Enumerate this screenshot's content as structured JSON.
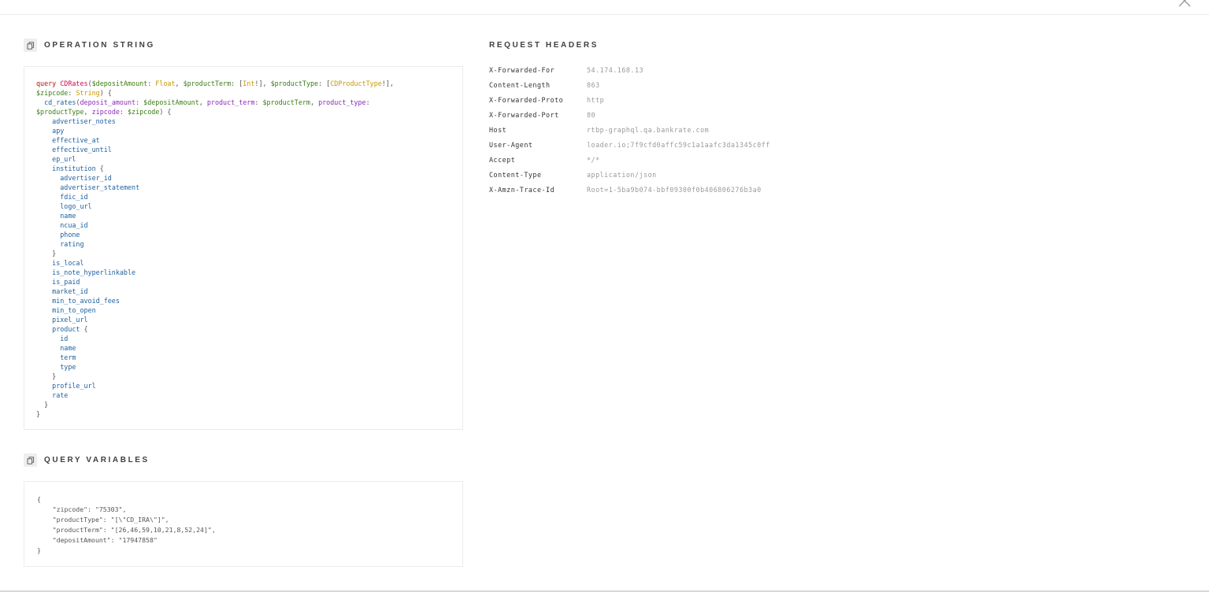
{
  "window": {
    "close_icon": "close-icon"
  },
  "operation": {
    "title": "OPERATION STRING",
    "copy_icon": "copy-icon",
    "lines": [
      [
        [
          "kw",
          "query "
        ],
        [
          "def",
          "CDRates"
        ],
        [
          "punct",
          "("
        ],
        [
          "var",
          "$depositAmount"
        ],
        [
          "punct",
          ": "
        ],
        [
          "type",
          "Float"
        ],
        [
          "punct",
          ", "
        ],
        [
          "var",
          "$productTerm"
        ],
        [
          "punct",
          ": ["
        ],
        [
          "type",
          "Int"
        ],
        [
          "punct",
          "!], "
        ],
        [
          "var",
          "$productType"
        ],
        [
          "punct",
          ": ["
        ],
        [
          "type",
          "CDProductType"
        ],
        [
          "punct",
          "!],"
        ]
      ],
      [
        [
          "var",
          "$zipcode"
        ],
        [
          "punct",
          ": "
        ],
        [
          "type",
          "String"
        ],
        [
          "punct",
          ") {"
        ]
      ],
      [
        [
          "punct",
          "  "
        ],
        [
          "field",
          "cd_rates"
        ],
        [
          "punct",
          "("
        ],
        [
          "attr",
          "deposit_amount"
        ],
        [
          "punct",
          ": "
        ],
        [
          "var",
          "$depositAmount"
        ],
        [
          "punct",
          ", "
        ],
        [
          "attr",
          "product_term"
        ],
        [
          "punct",
          ": "
        ],
        [
          "var",
          "$productTerm"
        ],
        [
          "punct",
          ", "
        ],
        [
          "attr",
          "product_type"
        ],
        [
          "punct",
          ":"
        ]
      ],
      [
        [
          "var",
          "$productType"
        ],
        [
          "punct",
          ", "
        ],
        [
          "attr",
          "zipcode"
        ],
        [
          "punct",
          ": "
        ],
        [
          "var",
          "$zipcode"
        ],
        [
          "punct",
          ") {"
        ]
      ],
      [
        [
          "punct",
          "    "
        ],
        [
          "field",
          "advertiser_notes"
        ]
      ],
      [
        [
          "punct",
          "    "
        ],
        [
          "field",
          "apy"
        ]
      ],
      [
        [
          "punct",
          "    "
        ],
        [
          "field",
          "effective_at"
        ]
      ],
      [
        [
          "punct",
          "    "
        ],
        [
          "field",
          "effective_until"
        ]
      ],
      [
        [
          "punct",
          "    "
        ],
        [
          "field",
          "ep_url"
        ]
      ],
      [
        [
          "punct",
          "    "
        ],
        [
          "field",
          "institution"
        ],
        [
          "punct",
          " {"
        ]
      ],
      [
        [
          "punct",
          "      "
        ],
        [
          "field",
          "advertiser_id"
        ]
      ],
      [
        [
          "punct",
          "      "
        ],
        [
          "field",
          "advertiser_statement"
        ]
      ],
      [
        [
          "punct",
          "      "
        ],
        [
          "field",
          "fdic_id"
        ]
      ],
      [
        [
          "punct",
          "      "
        ],
        [
          "field",
          "logo_url"
        ]
      ],
      [
        [
          "punct",
          "      "
        ],
        [
          "field",
          "name"
        ]
      ],
      [
        [
          "punct",
          "      "
        ],
        [
          "field",
          "ncua_id"
        ]
      ],
      [
        [
          "punct",
          "      "
        ],
        [
          "field",
          "phone"
        ]
      ],
      [
        [
          "punct",
          "      "
        ],
        [
          "field",
          "rating"
        ]
      ],
      [
        [
          "punct",
          "    }"
        ]
      ],
      [
        [
          "punct",
          "    "
        ],
        [
          "field",
          "is_local"
        ]
      ],
      [
        [
          "punct",
          "    "
        ],
        [
          "field",
          "is_note_hyperlinkable"
        ]
      ],
      [
        [
          "punct",
          "    "
        ],
        [
          "field",
          "is_paid"
        ]
      ],
      [
        [
          "punct",
          "    "
        ],
        [
          "field",
          "market_id"
        ]
      ],
      [
        [
          "punct",
          "    "
        ],
        [
          "field",
          "min_to_avoid_fees"
        ]
      ],
      [
        [
          "punct",
          "    "
        ],
        [
          "field",
          "min_to_open"
        ]
      ],
      [
        [
          "punct",
          "    "
        ],
        [
          "field",
          "pixel_url"
        ]
      ],
      [
        [
          "punct",
          "    "
        ],
        [
          "field",
          "product"
        ],
        [
          "punct",
          " {"
        ]
      ],
      [
        [
          "punct",
          "      "
        ],
        [
          "field",
          "id"
        ]
      ],
      [
        [
          "punct",
          "      "
        ],
        [
          "field",
          "name"
        ]
      ],
      [
        [
          "punct",
          "      "
        ],
        [
          "field",
          "term"
        ]
      ],
      [
        [
          "punct",
          "      "
        ],
        [
          "field",
          "type"
        ]
      ],
      [
        [
          "punct",
          "    }"
        ]
      ],
      [
        [
          "punct",
          "    "
        ],
        [
          "field",
          "profile_url"
        ]
      ],
      [
        [
          "punct",
          "    "
        ],
        [
          "field",
          "rate"
        ]
      ],
      [
        [
          "punct",
          "  }"
        ]
      ],
      [
        [
          "punct",
          "}"
        ]
      ]
    ]
  },
  "variables": {
    "title": "QUERY VARIABLES",
    "copy_icon": "copy-icon",
    "lines": [
      "{",
      "    \"zipcode\": \"75303\",",
      "    \"productType\": \"[\\\"CD_IRA\\\"]\",",
      "    \"productTerm\": \"[26,46,59,10,21,8,52,24]\",",
      "    \"depositAmount\": \"17947858\"",
      "}"
    ]
  },
  "headers": {
    "title": "REQUEST HEADERS",
    "rows": [
      {
        "key": "X-Forwarded-For",
        "value": "54.174.168.13"
      },
      {
        "key": "Content-Length",
        "value": "863"
      },
      {
        "key": "X-Forwarded-Proto",
        "value": "http"
      },
      {
        "key": "X-Forwarded-Port",
        "value": "80"
      },
      {
        "key": "Host",
        "value": "rtbp-graphql.qa.bankrate.com"
      },
      {
        "key": "User-Agent",
        "value": "loader.io;7f9cfd0affc59c1a1aafc3da1345c0ff"
      },
      {
        "key": "Accept",
        "value": "*/*"
      },
      {
        "key": "Content-Type",
        "value": "application/json"
      },
      {
        "key": "X-Amzn-Trace-Id",
        "value": "Root=1-5ba9b074-bbf09300f0b406806276b3a0"
      }
    ]
  },
  "colors": {
    "keyword": "#b11a04",
    "definition": "#d2054e",
    "variable": "#397d13",
    "type": "#ca9800",
    "attribute": "#8b2bb9",
    "field": "#1f61a0"
  }
}
